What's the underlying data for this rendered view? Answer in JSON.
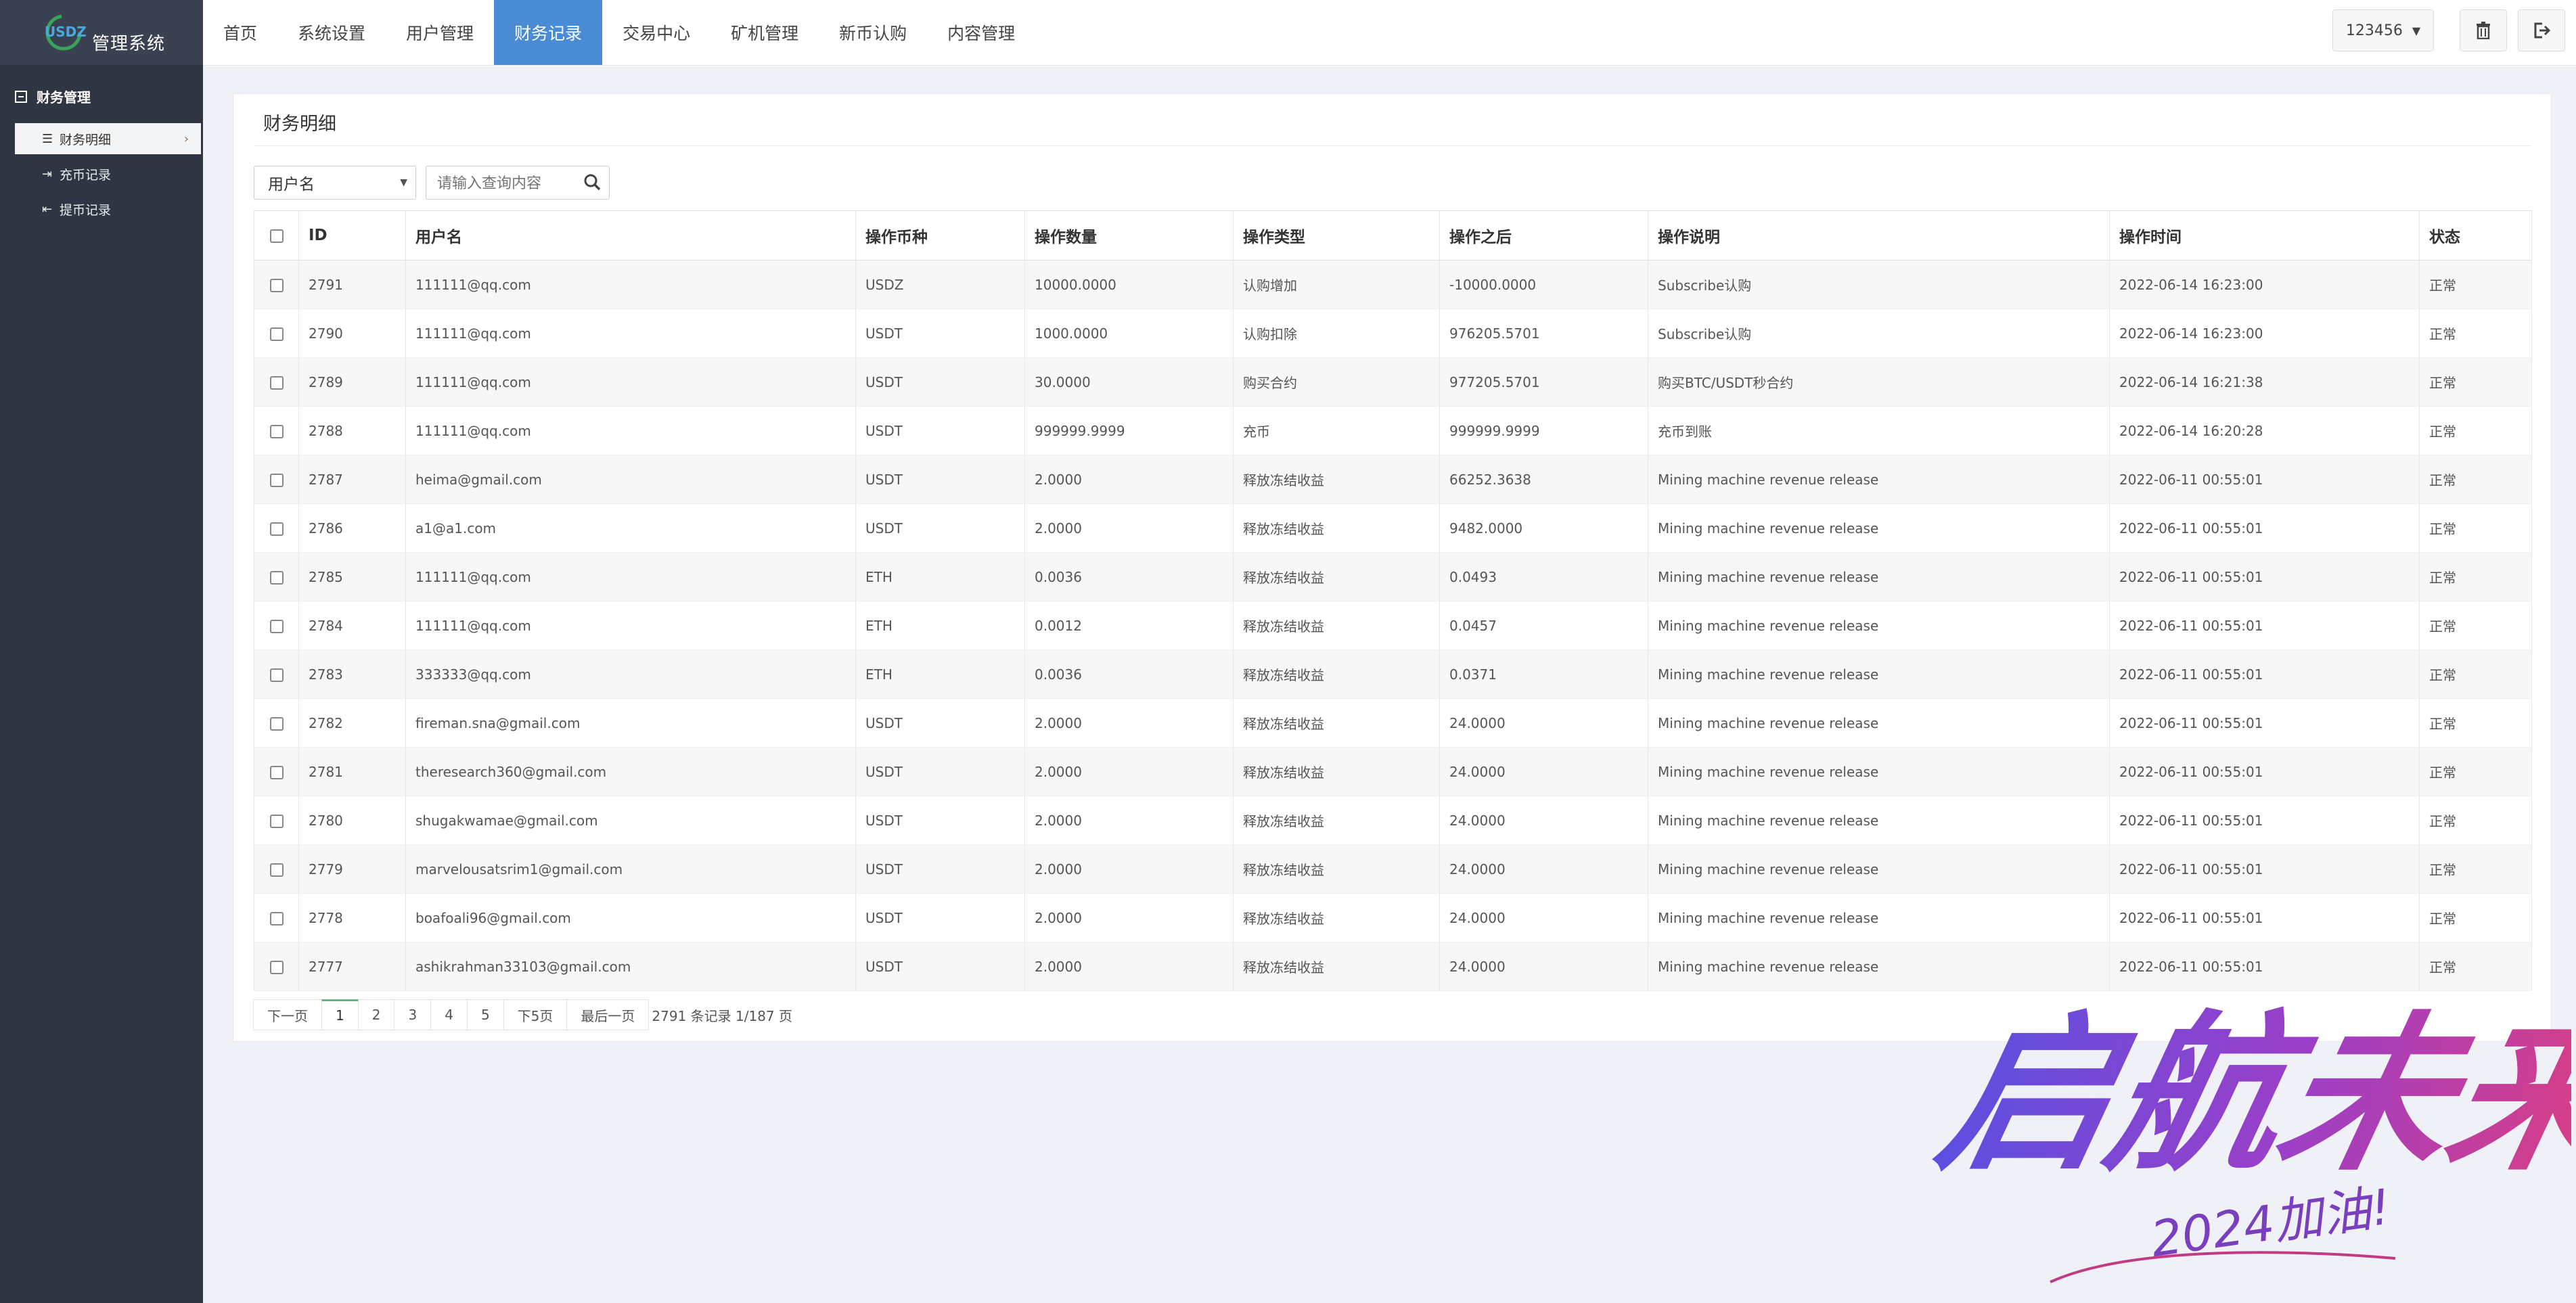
{
  "app": {
    "logo_text": "USDZ",
    "title": "管理系统"
  },
  "nav": {
    "items": [
      "首页",
      "系统设置",
      "用户管理",
      "财务记录",
      "交易中心",
      "矿机管理",
      "新币认购",
      "内容管理"
    ],
    "active_index": 3
  },
  "topbar": {
    "user": "123456",
    "trash_icon": "trash-icon",
    "logout_icon": "logout-icon"
  },
  "sidebar": {
    "section": "财务管理",
    "items": [
      {
        "label": "财务明细",
        "icon": "list-icon",
        "active": true
      },
      {
        "label": "充币记录",
        "icon": "deposit-icon",
        "active": false
      },
      {
        "label": "提币记录",
        "icon": "withdraw-icon",
        "active": false
      }
    ]
  },
  "panel": {
    "title": "财务明细",
    "filter_selected": "用户名",
    "search_placeholder": "请输入查询内容"
  },
  "table": {
    "headers": [
      "ID",
      "用户名",
      "操作币种",
      "操作数量",
      "操作类型",
      "操作之后",
      "操作说明",
      "操作时间",
      "状态"
    ],
    "rows": [
      [
        "2791",
        "111111@qq.com",
        "USDZ",
        "10000.0000",
        "认购增加",
        "-10000.0000",
        "Subscribe认购",
        "2022-06-14 16:23:00",
        "正常"
      ],
      [
        "2790",
        "111111@qq.com",
        "USDT",
        "1000.0000",
        "认购扣除",
        "976205.5701",
        "Subscribe认购",
        "2022-06-14 16:23:00",
        "正常"
      ],
      [
        "2789",
        "111111@qq.com",
        "USDT",
        "30.0000",
        "购买合约",
        "977205.5701",
        "购买BTC/USDT秒合约",
        "2022-06-14 16:21:38",
        "正常"
      ],
      [
        "2788",
        "111111@qq.com",
        "USDT",
        "999999.9999",
        "充币",
        "999999.9999",
        "充币到账",
        "2022-06-14 16:20:28",
        "正常"
      ],
      [
        "2787",
        "heima@gmail.com",
        "USDT",
        "2.0000",
        "释放冻结收益",
        "66252.3638",
        "Mining machine revenue release",
        "2022-06-11 00:55:01",
        "正常"
      ],
      [
        "2786",
        "a1@a1.com",
        "USDT",
        "2.0000",
        "释放冻结收益",
        "9482.0000",
        "Mining machine revenue release",
        "2022-06-11 00:55:01",
        "正常"
      ],
      [
        "2785",
        "111111@qq.com",
        "ETH",
        "0.0036",
        "释放冻结收益",
        "0.0493",
        "Mining machine revenue release",
        "2022-06-11 00:55:01",
        "正常"
      ],
      [
        "2784",
        "111111@qq.com",
        "ETH",
        "0.0012",
        "释放冻结收益",
        "0.0457",
        "Mining machine revenue release",
        "2022-06-11 00:55:01",
        "正常"
      ],
      [
        "2783",
        "333333@qq.com",
        "ETH",
        "0.0036",
        "释放冻结收益",
        "0.0371",
        "Mining machine revenue release",
        "2022-06-11 00:55:01",
        "正常"
      ],
      [
        "2782",
        "fireman.sna@gmail.com",
        "USDT",
        "2.0000",
        "释放冻结收益",
        "24.0000",
        "Mining machine revenue release",
        "2022-06-11 00:55:01",
        "正常"
      ],
      [
        "2781",
        "theresearch360@gmail.com",
        "USDT",
        "2.0000",
        "释放冻结收益",
        "24.0000",
        "Mining machine revenue release",
        "2022-06-11 00:55:01",
        "正常"
      ],
      [
        "2780",
        "shugakwamae@gmail.com",
        "USDT",
        "2.0000",
        "释放冻结收益",
        "24.0000",
        "Mining machine revenue release",
        "2022-06-11 00:55:01",
        "正常"
      ],
      [
        "2779",
        "marvelousatsrim1@gmail.com",
        "USDT",
        "2.0000",
        "释放冻结收益",
        "24.0000",
        "Mining machine revenue release",
        "2022-06-11 00:55:01",
        "正常"
      ],
      [
        "2778",
        "boafoali96@gmail.com",
        "USDT",
        "2.0000",
        "释放冻结收益",
        "24.0000",
        "Mining machine revenue release",
        "2022-06-11 00:55:01",
        "正常"
      ],
      [
        "2777",
        "ashikrahman33103@gmail.com",
        "USDT",
        "2.0000",
        "释放冻结收益",
        "24.0000",
        "Mining machine revenue release",
        "2022-06-11 00:55:01",
        "正常"
      ]
    ]
  },
  "pagination": {
    "prev": "下一页",
    "pages": [
      "1",
      "2",
      "3",
      "4",
      "5"
    ],
    "current": "1",
    "next5": "下5页",
    "last": "最后一页",
    "info": "2791 条记录 1/187 页"
  },
  "watermark": {
    "text_main": "启航未来",
    "text_sub": "2024加油!"
  }
}
